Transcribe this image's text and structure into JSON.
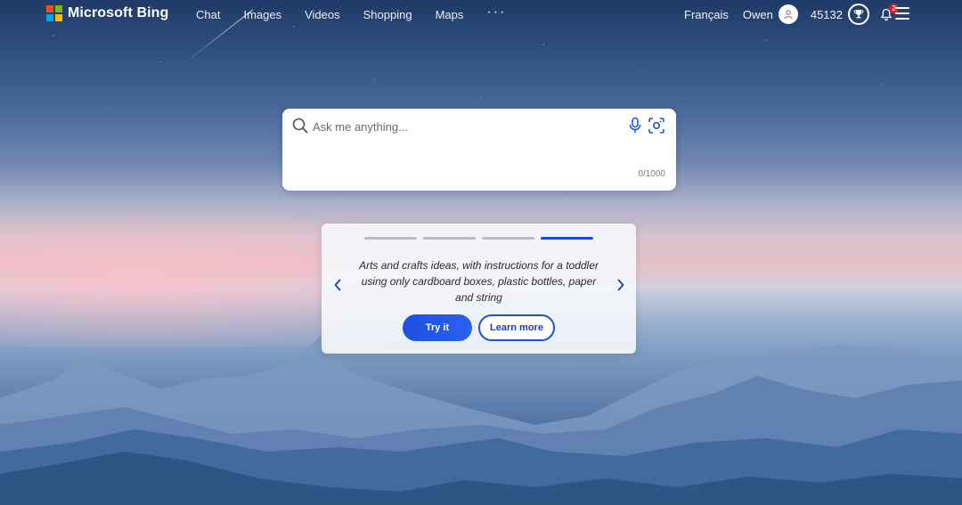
{
  "brand": {
    "name": "Microsoft Bing",
    "logo_colors": [
      "#f25022",
      "#7fba00",
      "#00a4ef",
      "#ffb900"
    ]
  },
  "nav": {
    "items": [
      "Chat",
      "Images",
      "Videos",
      "Shopping",
      "Maps"
    ],
    "more": "···"
  },
  "header_right": {
    "language": "Français",
    "user": "Owen",
    "points": "45132",
    "notifications_count": "2"
  },
  "search": {
    "placeholder": "Ask me anything...",
    "counter": "0/1000"
  },
  "suggestion": {
    "prompt": "Arts and crafts ideas, with instructions for a toddler using only cardboard boxes, plastic bottles, paper and string",
    "try_label": "Try it",
    "learn_label": "Learn more",
    "slide_count": 4,
    "active_slide": 4
  },
  "colors": {
    "accent": "#174ae4",
    "badge": "#d6202b"
  }
}
